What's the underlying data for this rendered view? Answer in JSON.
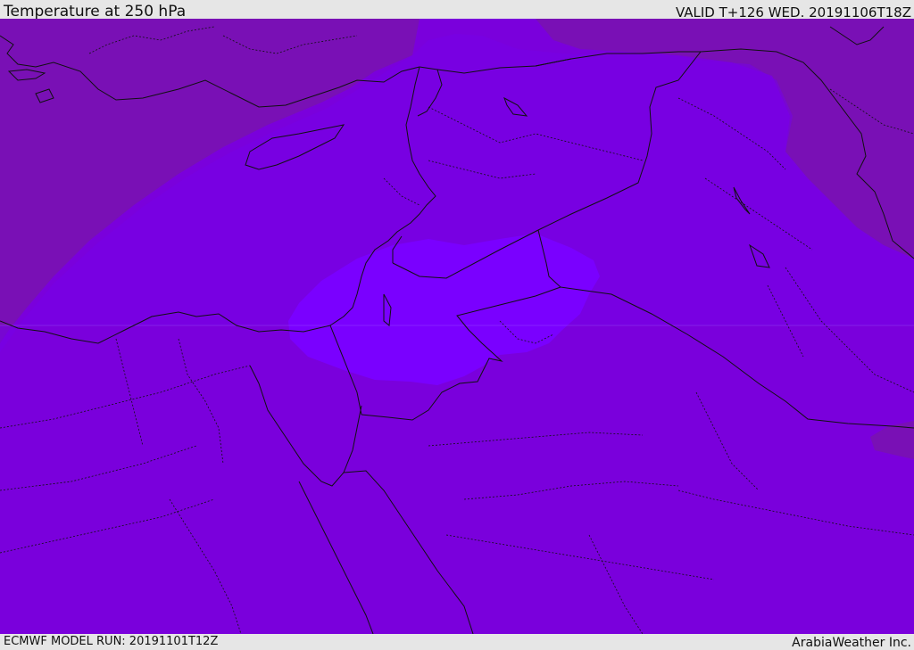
{
  "header": {
    "title": "Temperature at 250 hPa",
    "valid": "VALID T+126 WED. 20191106T18Z"
  },
  "footer": {
    "model_run": "ECMWF MODEL RUN: 20191101T12Z",
    "credit": "ArabiaWeather Inc."
  },
  "map": {
    "colors": {
      "field_warmer": "#7910b5",
      "field_main": "#7a00dc",
      "field_cold": "#7900f5",
      "field_core": "#7a00ff",
      "boundaries": "#111111"
    },
    "region": "Eastern Mediterranean and Middle East"
  }
}
